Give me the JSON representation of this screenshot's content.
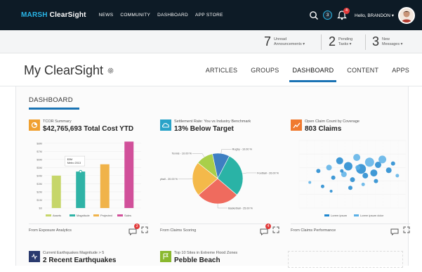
{
  "brand": {
    "part1": "MARSH",
    "part2": "ClearSight"
  },
  "top_nav": [
    "NEWS",
    "COMMUNITY",
    "DASHBOARD",
    "APP STORE"
  ],
  "user": {
    "badge_count": "3",
    "notif_count": "4",
    "greeting": "Hello, BRANDON ▾"
  },
  "stats": [
    {
      "num": "7",
      "line1": "Unread",
      "line2": "Announcements ▾"
    },
    {
      "num": "2",
      "line1": "Pending",
      "line2": "Tasks ▾"
    },
    {
      "num": "3",
      "line1": "New",
      "line2": "Messages ▾"
    }
  ],
  "page_title": "My ClearSight",
  "main_nav": [
    "ARTICLES",
    "GROUPS",
    "DASHBOARD",
    "CONTENT",
    "APPS"
  ],
  "main_nav_active": "DASHBOARD",
  "section_title": "DASHBOARD",
  "cards": [
    {
      "subtitle": "TCOR Summary",
      "headline": "$42,765,693 Total Cost YTD",
      "footer": "From Exposure Analytics",
      "icon": "pie-icon",
      "icon_color": "#f0a030",
      "comment_count": "3"
    },
    {
      "subtitle": "Settlement Rate: You vs Industry Benchmark",
      "headline": "13% Below Target",
      "footer": "From Claims Scoring",
      "icon": "cloud-icon",
      "icon_color": "#29a3c8",
      "comment_count": "4"
    },
    {
      "subtitle": "Open Claim Count by Coverage",
      "headline": "803 Claims",
      "footer": "From Claims Performance",
      "icon": "trend-icon",
      "icon_color": "#f07a30",
      "comment_count": ""
    }
  ],
  "cards_row2": [
    {
      "subtitle": "Current Earthquakes Magnitude > 5",
      "headline": "2 Recent Earthquakes",
      "icon_color": "#2a3a6e"
    },
    {
      "subtitle": "Top 10 Sites in Extreme Flood Zones",
      "headline": "Pebble Beach",
      "icon_color": "#8ab82e"
    }
  ],
  "chart_data": [
    {
      "type": "bar",
      "categories": [
        "Assets",
        "Magnitude",
        "Projected",
        "Sales"
      ],
      "values": [
        4,
        4.5,
        5.4,
        8.2
      ],
      "colors": [
        "#c6d66a",
        "#2fb3a6",
        "#f0b34a",
        "#d1509a"
      ],
      "yticks": [
        "$0",
        "$1M",
        "$2M",
        "$3M",
        "$4M",
        "$5M",
        "$6M",
        "$7M",
        "$8M"
      ],
      "ylim": [
        0,
        8.5
      ],
      "tooltip": {
        "line1": "$3M",
        "line2": "Metro 2013"
      }
    },
    {
      "type": "pie",
      "values": [
        10,
        10,
        26,
        25,
        20
      ],
      "labels": [
        "Tennis - 10.00 %",
        "Rugby - 10.00 %",
        "Football - 26.00 %",
        "Basketball - 25.00 %",
        "Volleyball - 20.00 %"
      ],
      "colors": [
        "#a9cf4a",
        "#3e7fc2",
        "#2ab3a6",
        "#ef6b5e",
        "#f4b94a"
      ]
    },
    {
      "type": "scatter",
      "series": [
        {
          "name": "Lorem ipsum",
          "color": "#1e87cf"
        },
        {
          "name": "Lorem ipsum dolor",
          "color": "#5ab0e6"
        }
      ],
      "points": [
        [
          10,
          38,
          2
        ],
        [
          18,
          55,
          3
        ],
        [
          22,
          32,
          2.5
        ],
        [
          28,
          60,
          4
        ],
        [
          32,
          45,
          3
        ],
        [
          38,
          70,
          5
        ],
        [
          42,
          50,
          4
        ],
        [
          46,
          62,
          6
        ],
        [
          50,
          42,
          3.5
        ],
        [
          54,
          75,
          5
        ],
        [
          58,
          58,
          7
        ],
        [
          62,
          48,
          4
        ],
        [
          66,
          68,
          6.5
        ],
        [
          70,
          52,
          5
        ],
        [
          74,
          64,
          4.5
        ],
        [
          78,
          72,
          5.5
        ],
        [
          84,
          56,
          4
        ],
        [
          88,
          66,
          3
        ],
        [
          92,
          48,
          2.5
        ],
        [
          30,
          25,
          2
        ],
        [
          48,
          30,
          3
        ],
        [
          60,
          35,
          2.5
        ],
        [
          72,
          40,
          3
        ],
        [
          40,
          55,
          2.5
        ],
        [
          55,
          60,
          3.5
        ]
      ],
      "xlim": [
        0,
        100
      ],
      "ylim": [
        0,
        100
      ]
    }
  ]
}
